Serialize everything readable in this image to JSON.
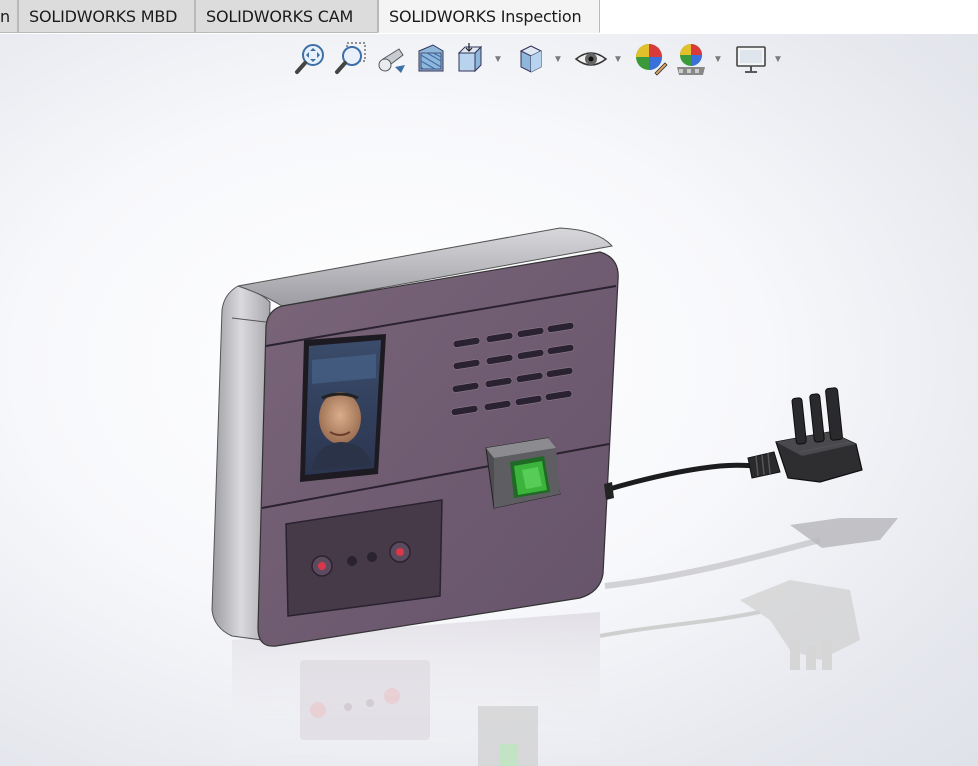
{
  "tabs": [
    {
      "label": "n"
    },
    {
      "label": "SOLIDWORKS MBD"
    },
    {
      "label": "SOLIDWORKS CAM"
    },
    {
      "label": "SOLIDWORKS Inspection"
    }
  ],
  "active_tab": "SOLIDWORKS Inspection",
  "heads_up_toolbar": [
    {
      "icon": "zoom-to-fit-icon"
    },
    {
      "icon": "zoom-to-area-icon"
    },
    {
      "icon": "previous-view-icon"
    },
    {
      "icon": "section-view-icon"
    },
    {
      "icon": "view-orientation-icon",
      "dropdown": true
    },
    {
      "icon": "display-style-icon",
      "dropdown": true
    },
    {
      "icon": "hide-show-items-icon",
      "dropdown": true
    },
    {
      "icon": "edit-appearance-icon"
    },
    {
      "icon": "apply-scene-icon",
      "dropdown": true
    },
    {
      "icon": "view-settings-icon",
      "dropdown": true
    }
  ],
  "colors": {
    "device_face": "#6e5a6e",
    "device_frame": "#bfbfc4",
    "viewport_background": "#f2f3f7",
    "sensor_green": "#3cb43c"
  }
}
